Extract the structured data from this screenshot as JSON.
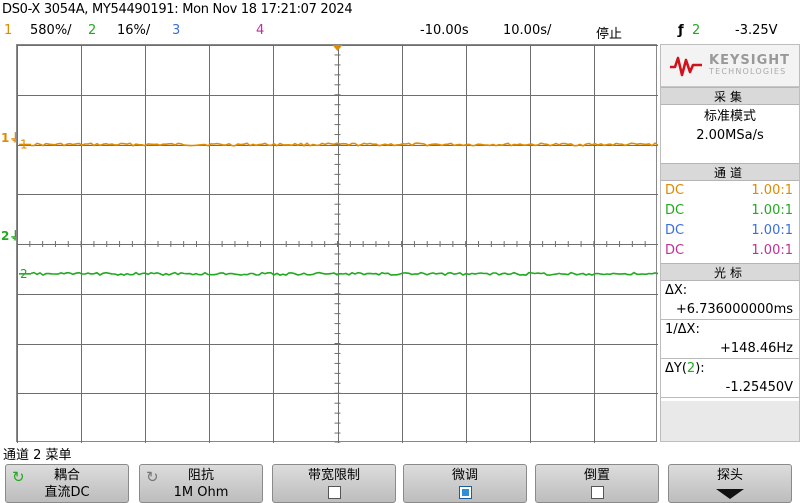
{
  "header": {
    "title": "DS0-X 3054A, MY54490191: Mon Nov 18 17:21:07 2024"
  },
  "status": {
    "ch1_num": "1",
    "ch1_scale": "580%/",
    "ch2_num": "2",
    "ch2_scale": "16%/",
    "ch3_num": "3",
    "ch4_num": "4",
    "time_delay": "-10.00s",
    "time_scale": "10.00s/",
    "run_state": "停止",
    "trigger_symbol": "ƒ",
    "trigger_source": "2",
    "trigger_level": "-3.25V"
  },
  "screen": {
    "ch1_marker": "1",
    "ch2_marker": "2",
    "ch1_level_div": 2.0,
    "ch2_level_div": -0.6,
    "colors": {
      "ch1": "#e08a00",
      "ch2": "#1faa1f",
      "ch3": "#3a6fdc",
      "ch4": "#c0309a",
      "grid": "#6e6e6e"
    }
  },
  "panel": {
    "logo_main": "KEYSIGHT",
    "logo_sub": "TECHNOLOGIES",
    "acq_title": "采集",
    "acq_mode": "标准模式",
    "acq_rate": "2.00MSa/s",
    "chan_title": "通道",
    "channels": [
      {
        "coupling": "DC",
        "probe": "1.00:1"
      },
      {
        "coupling": "DC",
        "probe": "1.00:1"
      },
      {
        "coupling": "DC",
        "probe": "1.00:1"
      },
      {
        "coupling": "DC",
        "probe": "1.00:1"
      }
    ],
    "cursor_title": "光标",
    "dx_label": "ΔX:",
    "dx_value": "+6.736000000ms",
    "inv_dx_label": "1/ΔX:",
    "inv_dx_value": "+148.46Hz",
    "dy_label_prefix": "ΔY(",
    "dy_label_ch": "2",
    "dy_label_suffix": "):",
    "dy_value": "-1.25450V"
  },
  "menu": {
    "title": "通道 2 菜单",
    "softkeys": [
      {
        "label": "耦合",
        "value": "直流DC"
      },
      {
        "label": "阻抗",
        "value": "1M Ohm"
      },
      {
        "label": "带宽限制",
        "checked": false
      },
      {
        "label": "微调",
        "checked": true
      },
      {
        "label": "倒置",
        "checked": false
      },
      {
        "label": "探头"
      }
    ]
  }
}
